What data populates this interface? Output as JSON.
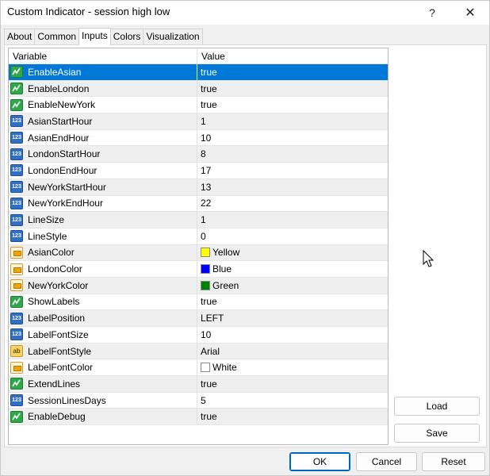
{
  "window": {
    "title": "Custom Indicator - session high low",
    "help_label": "?",
    "close_label": "✕"
  },
  "tabs": [
    {
      "label": "About",
      "active": false
    },
    {
      "label": "Common",
      "active": false
    },
    {
      "label": "Inputs",
      "active": true
    },
    {
      "label": "Colors",
      "active": false
    },
    {
      "label": "Visualization",
      "active": false
    }
  ],
  "grid": {
    "headers": {
      "variable": "Variable",
      "value": "Value"
    },
    "rows": [
      {
        "type": "bool",
        "variable": "EnableAsian",
        "value": "true",
        "selected": true
      },
      {
        "type": "bool",
        "variable": "EnableLondon",
        "value": "true"
      },
      {
        "type": "bool",
        "variable": "EnableNewYork",
        "value": "true"
      },
      {
        "type": "int",
        "variable": "AsianStartHour",
        "value": "1"
      },
      {
        "type": "int",
        "variable": "AsianEndHour",
        "value": "10"
      },
      {
        "type": "int",
        "variable": "LondonStartHour",
        "value": "8"
      },
      {
        "type": "int",
        "variable": "LondonEndHour",
        "value": "17"
      },
      {
        "type": "int",
        "variable": "NewYorkStartHour",
        "value": "13"
      },
      {
        "type": "int",
        "variable": "NewYorkEndHour",
        "value": "22"
      },
      {
        "type": "int",
        "variable": "LineSize",
        "value": "1"
      },
      {
        "type": "int",
        "variable": "LineStyle",
        "value": "0"
      },
      {
        "type": "color",
        "variable": "AsianColor",
        "value": "Yellow",
        "swatch": "#ffff00"
      },
      {
        "type": "color",
        "variable": "LondonColor",
        "value": "Blue",
        "swatch": "#0000ff"
      },
      {
        "type": "color",
        "variable": "NewYorkColor",
        "value": "Green",
        "swatch": "#008000"
      },
      {
        "type": "bool",
        "variable": "ShowLabels",
        "value": "true"
      },
      {
        "type": "int",
        "variable": "LabelPosition",
        "value": "LEFT"
      },
      {
        "type": "int",
        "variable": "LabelFontSize",
        "value": "10"
      },
      {
        "type": "str",
        "variable": "LabelFontStyle",
        "value": "Arial"
      },
      {
        "type": "color",
        "variable": "LabelFontColor",
        "value": "White",
        "swatch": "#ffffff"
      },
      {
        "type": "bool",
        "variable": "ExtendLines",
        "value": "true"
      },
      {
        "type": "int",
        "variable": "SessionLinesDays",
        "value": "5"
      },
      {
        "type": "bool",
        "variable": "EnableDebug",
        "value": "true"
      }
    ]
  },
  "icons": {
    "bool": "bool-icon",
    "int": "integer-icon",
    "color": "color-icon",
    "str": "string-icon",
    "int_glyph": "123",
    "str_glyph": "ab"
  },
  "buttons": {
    "load": "Load",
    "save": "Save",
    "ok": "OK",
    "cancel": "Cancel",
    "reset": "Reset"
  },
  "colors": {
    "selection": "#0078d7",
    "accent": "#0067c0"
  }
}
